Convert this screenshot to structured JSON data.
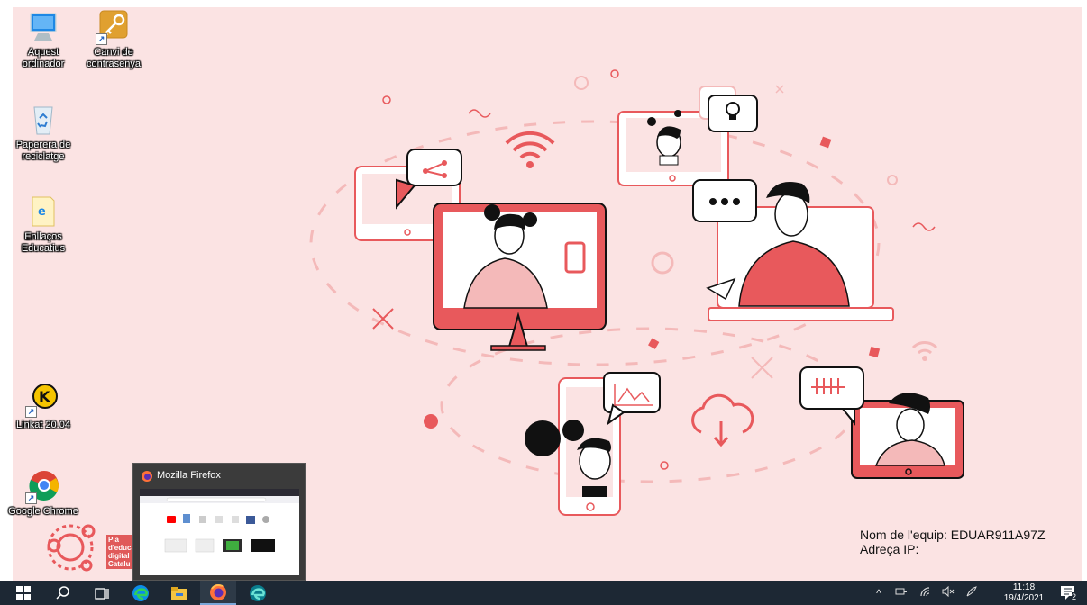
{
  "desktop": {
    "icons": [
      {
        "label": "Aquest ordinador"
      },
      {
        "label": "Canvi de contrasenya"
      },
      {
        "label": "Paperera de reciclatge"
      },
      {
        "label": "Enllaços Educatius"
      },
      {
        "label": "Linkat 20.04"
      },
      {
        "label": "Google Chrome"
      }
    ]
  },
  "sysinfo": {
    "computer_name": "Nom de l'equip: EDUAR911A97Z",
    "ip_address": "Adreça IP:"
  },
  "wallpaper": {
    "logo_text": [
      "Pla",
      "d'educa",
      "digital",
      "Catalu"
    ]
  },
  "preview": {
    "title": "Mozilla Firefox"
  },
  "taskbar": {
    "clock_time": "11:18",
    "clock_date": "19/4/2021",
    "notification_count": "2"
  },
  "colors": {
    "accent_coral": "#e8595c",
    "wallpaper_bg": "#fbe3e3",
    "taskbar_bg": "#1d2834"
  }
}
